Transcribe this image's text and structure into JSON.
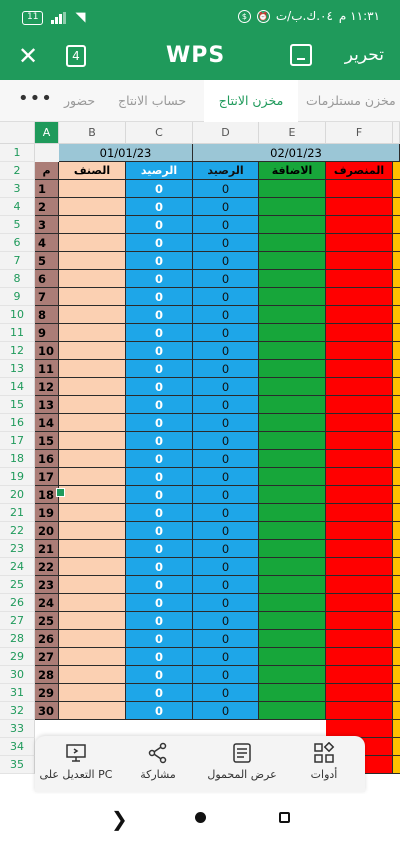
{
  "status_bar": {
    "battery": "11",
    "time": "١١:٣١ م",
    "date_marker": "٠٤.ك.ب/ت"
  },
  "app_bar": {
    "logo": "WPS",
    "tab_count": "4",
    "edit_label": "تحرير",
    "accent_color": "#1f9a5b"
  },
  "sheet_tabs": {
    "more": "•••",
    "tabs": [
      "مخزن مستلزمات",
      "مخزن الانتاج",
      "حساب الانتاج",
      "حضور"
    ],
    "active_index": 1
  },
  "grid": {
    "columns": [
      "A",
      "B",
      "C",
      "D",
      "E",
      "F"
    ],
    "selected_column": "A",
    "row_numbers": [
      "1",
      "2",
      "3",
      "4",
      "5",
      "6",
      "7",
      "8",
      "9",
      "10",
      "11",
      "12",
      "13",
      "14",
      "15",
      "16",
      "17",
      "18",
      "19",
      "20",
      "21",
      "22",
      "23",
      "24",
      "25",
      "26",
      "27",
      "28",
      "29",
      "30",
      "31",
      "32",
      "33",
      "34",
      "35"
    ],
    "dates": [
      "01/01/23",
      "02/01/23"
    ],
    "headers": {
      "index": "م",
      "item": "الصنف",
      "balance": "الرصيد",
      "balance2": "الرصيد",
      "addition": "الاضافة",
      "spent": "المنصرف"
    },
    "item_numbers": [
      "1",
      "2",
      "3",
      "4",
      "5",
      "6",
      "7",
      "8",
      "9",
      "10",
      "11",
      "12",
      "13",
      "14",
      "15",
      "16",
      "17",
      "18",
      "19",
      "20",
      "21",
      "22",
      "23",
      "24",
      "25",
      "26",
      "27",
      "28",
      "29",
      "30"
    ],
    "balance_values": [
      "0",
      "0",
      "0",
      "0",
      "0",
      "0",
      "0",
      "0",
      "0",
      "0",
      "0",
      "0",
      "0",
      "0",
      "0",
      "0",
      "0",
      "0",
      "0",
      "0",
      "0",
      "0",
      "0",
      "0",
      "0",
      "0",
      "0",
      "0",
      "0",
      "0"
    ],
    "colors": {
      "index": "#ab7d77",
      "item": "#fbd0b2",
      "balance": "#1ea6e8",
      "addition": "#17a63a",
      "spent": "#ff0000",
      "next": "#ffc000",
      "date": "#9bc6d6"
    }
  },
  "toolbar": {
    "items": [
      {
        "label": "أدوات",
        "icon": "tools-icon"
      },
      {
        "label": "عرض المحمول",
        "icon": "mobile-view-icon"
      },
      {
        "label": "مشاركة",
        "icon": "share-icon"
      },
      {
        "label": "التعديل على PC",
        "icon": "edit-on-pc-icon"
      }
    ]
  },
  "navbar": {
    "back": "back-icon",
    "home": "home-icon",
    "recent": "recent-apps-icon"
  }
}
